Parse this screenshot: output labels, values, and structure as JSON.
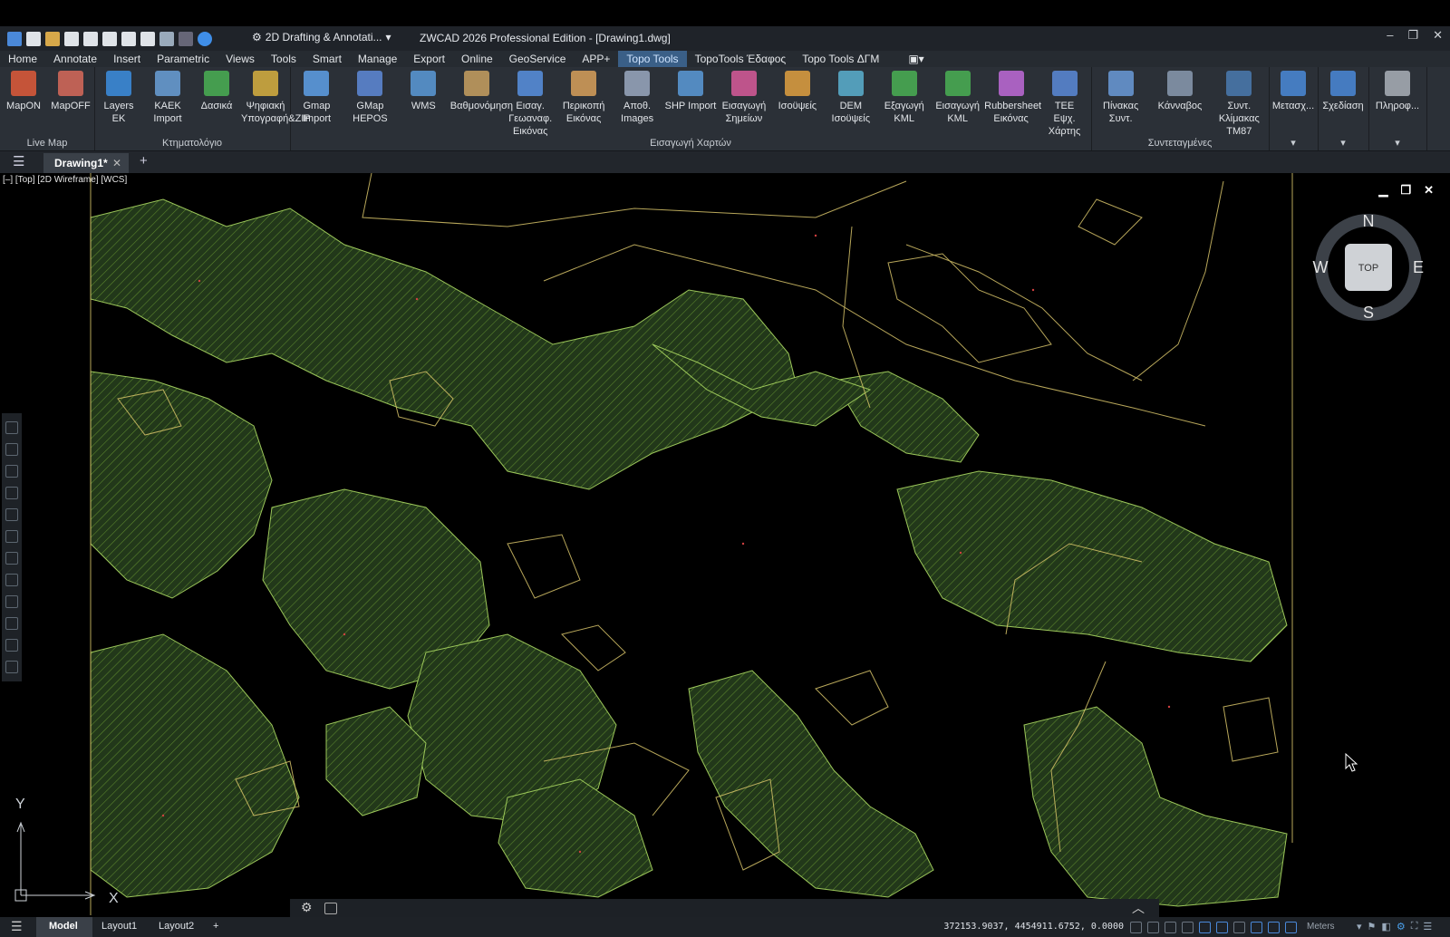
{
  "title_bar": {
    "workspace": "2D Drafting & Annotati...",
    "app_title": "ZWCAD 2026 Professional Edition - [Drawing1.dwg]"
  },
  "menu": [
    "Home",
    "Annotate",
    "Insert",
    "Parametric",
    "Views",
    "Tools",
    "Smart",
    "Manage",
    "Export",
    "Online",
    "GeoService",
    "APP+",
    "Topo Tools",
    "TopoTools Έδαφος",
    "Topo Tools ΔΓΜ"
  ],
  "menu_active": "Topo Tools",
  "ribbon": {
    "panels": [
      {
        "label": "Live Map",
        "buttons": [
          "MapON",
          "MapOFF"
        ]
      },
      {
        "label": "Κτηματολόγιο",
        "buttons": [
          "Layers\nEK",
          "ΚΑΕΚ\nImport",
          "Δασικά",
          "Ψηφιακή\nΥπογραφή&ZIP"
        ]
      },
      {
        "label": "Εισαγωγή Χαρτών",
        "buttons": [
          "Gmap\nImport",
          "GMap\nHEPOS",
          "WMS",
          "Βαθμονόμηση",
          "Εισαγ. Γεωαναφ.\nΕικόνας",
          "Περικοπή\nΕικόνας",
          "Αποθ.\nImages",
          "SHP Import",
          "Εισαγωγή\nΣημείων",
          "Ισοϋψείς",
          "DEM\nΙσοϋψείς",
          "Εξαγωγή\nKML",
          "Εισαγωγή\nKML",
          "Rubbersheet\nΕικόνας",
          "TEE\nΕψχ. Χάρτης"
        ]
      },
      {
        "label": "Συντεταγμένες",
        "buttons": [
          "Πίνακας\nΣυντ.",
          "Κάνναβος",
          "Συντ. Κλίμακας\nTM87"
        ]
      },
      {
        "label": "",
        "buttons": [
          "Μετασχ..."
        ]
      },
      {
        "label": "",
        "buttons": [
          "Σχεδίαση"
        ]
      },
      {
        "label": "",
        "buttons": [
          "Πληροφ..."
        ]
      }
    ]
  },
  "document_tab": "Drawing1*",
  "viewport_label": "[–] [Top] [2D Wireframe] [WCS]",
  "viewcube": {
    "n": "N",
    "s": "S",
    "e": "E",
    "w": "W",
    "face": "TOP"
  },
  "ucs": {
    "x": "X",
    "y": "Y"
  },
  "status": {
    "layout_tabs": [
      "Model",
      "Layout1",
      "Layout2"
    ],
    "coords": "372153.9037, 4454911.6752, 0.0000",
    "units": "Meters"
  },
  "colors": {
    "polygon_fill": "#2e4a1c",
    "polygon_line": "#8db84a",
    "parcel_line": "#d8c46a",
    "accent": "#3a5f87"
  }
}
